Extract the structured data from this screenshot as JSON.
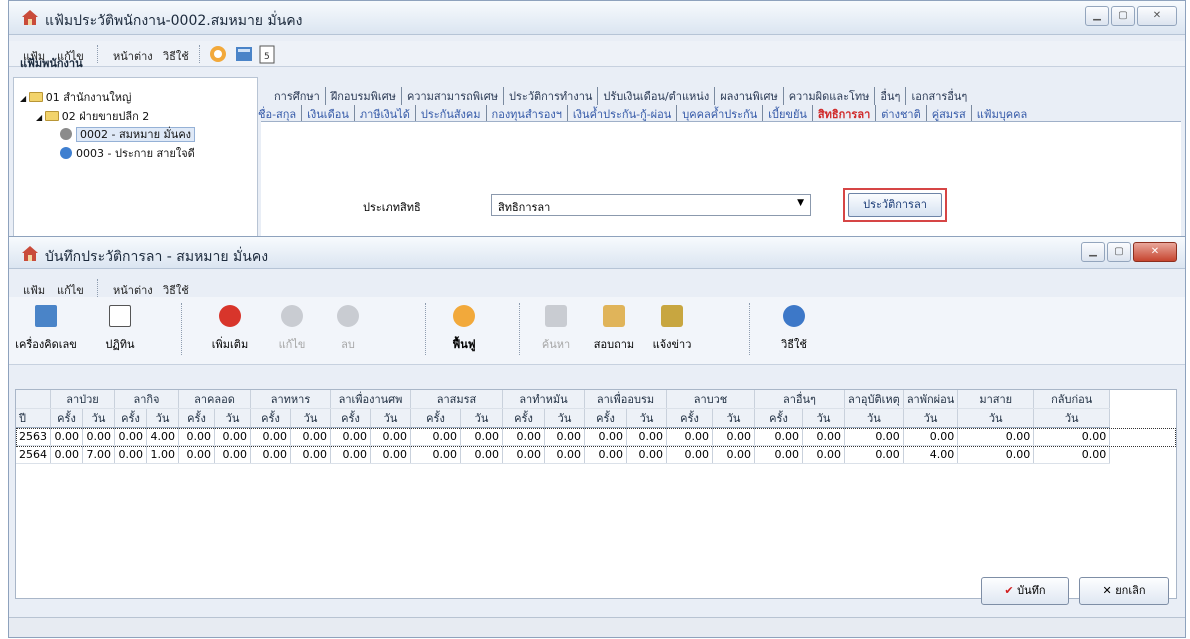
{
  "win1": {
    "title": "แฟ้มประวัติพนักงาน-0002.สมหมาย มั่นคง",
    "menu": [
      "แฟ้ม",
      "แก้ไข",
      "หน้าต่าง",
      "วิธีใช้"
    ],
    "tree": {
      "header": "แฟ้มพนักงาน",
      "nodes": [
        "01 สำนักงานใหญ่",
        "02 ฝ่ายขายปลีก 2",
        "0002 - สมหมาย มั่นคง",
        "0003 - ประกาย สายใจดี"
      ]
    },
    "tabs_row1": [
      "การศึกษา",
      "ฝึกอบรมพิเศษ",
      "ความสามารถพิเศษ",
      "ประวัติการทำงาน",
      "ปรับเงินเดือน/ตำแหน่ง",
      "ผลงานพิเศษ",
      "ความผิดและโทษ",
      "อื่นๆ",
      "เอกสารอื่นๆ"
    ],
    "tabs_row2": [
      "ชื่อ-สกุล",
      "เงินเดือน",
      "ภาษีเงินได้",
      "ประกันสังคม",
      "กองทุนสำรองฯ",
      "เงินค้ำประกัน-กู้-ผ่อน",
      "บุคคลค้ำประกัน",
      "เบี้ยขยัน",
      "สิทธิการลา",
      "ต่างชาติ",
      "คู่สมรส",
      "แฟ้มบุคคล"
    ],
    "active_tab": "สิทธิการลา",
    "right_label": "ประเภทสิทธิ",
    "right_combo": "สิทธิการลา",
    "history_button": "ประวัติการลา"
  },
  "win2": {
    "title": "บันทึกประวัติการลา - สมหมาย มั่นคง",
    "menu": [
      "แฟ้ม",
      "แก้ไข",
      "หน้าต่าง",
      "วิธีใช้"
    ],
    "toolbar": [
      "เครื่องคิดเลข",
      "ปฏิทิน",
      "เพิ่มเติม",
      "แก้ไข",
      "ลบ",
      "ฟื้นฟู",
      "ค้นหา",
      "สอบถาม",
      "แจ้งข่าว",
      "วิธีใช้"
    ],
    "grid": {
      "groups": [
        "ลาป่วย",
        "ลากิจ",
        "ลาคลอด",
        "ลาทหาร",
        "ลาเพื่องานศพ",
        "ลาสมรส",
        "ลาทำหมัน",
        "ลาเพื่ออบรม",
        "ลาบวช",
        "ลาอื่นๆ",
        "ลาอุบัติเหตุ",
        "ลาพักผ่อน",
        "มาสาย",
        "กลับก่อน"
      ],
      "year_label": "ปี",
      "times_label": "ครั้ง",
      "days_label": "วัน",
      "rows": [
        [
          "2563",
          "0.00",
          "0.00",
          "0.00",
          "4.00",
          "0.00",
          "0.00",
          "0.00",
          "0.00",
          "0.00",
          "0.00",
          "0.00",
          "0.00",
          "0.00",
          "0.00",
          "0.00",
          "0.00",
          "0.00",
          "0.00",
          "0.00",
          "0.00",
          "0.00",
          "0.00",
          "0.00",
          "0.00"
        ],
        [
          "2564",
          "0.00",
          "7.00",
          "0.00",
          "1.00",
          "0.00",
          "0.00",
          "0.00",
          "0.00",
          "0.00",
          "0.00",
          "0.00",
          "0.00",
          "0.00",
          "0.00",
          "0.00",
          "0.00",
          "0.00",
          "0.00",
          "0.00",
          "0.00",
          "0.00",
          "4.00",
          "0.00",
          "0.00"
        ]
      ]
    },
    "save_button": "บันทึก",
    "cancel_button": "ยกเลิก"
  },
  "colors": {
    "accent_red": "#d64545",
    "link_blue": "#3459a8"
  }
}
